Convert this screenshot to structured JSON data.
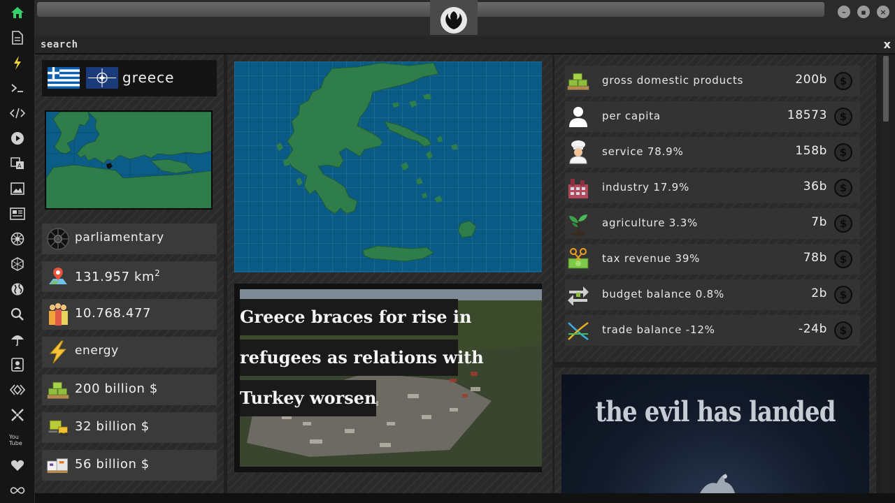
{
  "search": {
    "label": "search",
    "close": "x"
  },
  "window": {
    "minimize": "–",
    "restore": "▪",
    "close": "×"
  },
  "dock": {
    "items": [
      "home-icon",
      "document-icon",
      "bolt-icon",
      "terminal-icon",
      "code-icon",
      "play-icon",
      "translate-icon",
      "image-icon",
      "newspaper-icon",
      "empire-icon",
      "hexagon-icon",
      "globe-icon",
      "search-icon",
      "umbrella-icon",
      "contact-icon",
      "diamond-code-icon",
      "crosshair-icon",
      "youtube-icon",
      "heart-icon",
      "infinity-icon"
    ],
    "active": "home-icon",
    "youtube_text": "You Tube"
  },
  "country": {
    "name": "greece",
    "government": "parliamentary",
    "area": "131.957 km",
    "area_sup": "2",
    "population": "10.768.477",
    "sector": "energy",
    "value1": "200 billion $",
    "value2": "32 billion $",
    "value3": "56 billion $"
  },
  "news": {
    "line1": " Greece braces for rise in",
    "line2": "refugees as relations with",
    "line3": "Turkey worsen"
  },
  "stats": [
    {
      "label": "gross domestic products",
      "value": "200b",
      "icon": "money-stack-icon"
    },
    {
      "label": "per capita",
      "value": "18573",
      "icon": "person-icon"
    },
    {
      "label": "service 78.9%",
      "value": "158b",
      "icon": "chef-icon"
    },
    {
      "label": "industry 17.9%",
      "value": "36b",
      "icon": "factory-icon"
    },
    {
      "label": "agriculture 3.3%",
      "value": "7b",
      "icon": "sprout-icon"
    },
    {
      "label": "tax revenue 39%",
      "value": "78b",
      "icon": "scissors-money-icon"
    },
    {
      "label": "budget balance 0.8%",
      "value": "2b",
      "icon": "exchange-icon"
    },
    {
      "label": "trade balance -12%",
      "value": "-24b",
      "icon": "crossed-arrows-icon"
    }
  ],
  "currency_symbol": "$",
  "ad": {
    "headline": "the evil has landed"
  },
  "colors": {
    "map_sea": "#0a5a86",
    "map_land": "#2e7d4b",
    "accent_green": "#35d06a"
  }
}
